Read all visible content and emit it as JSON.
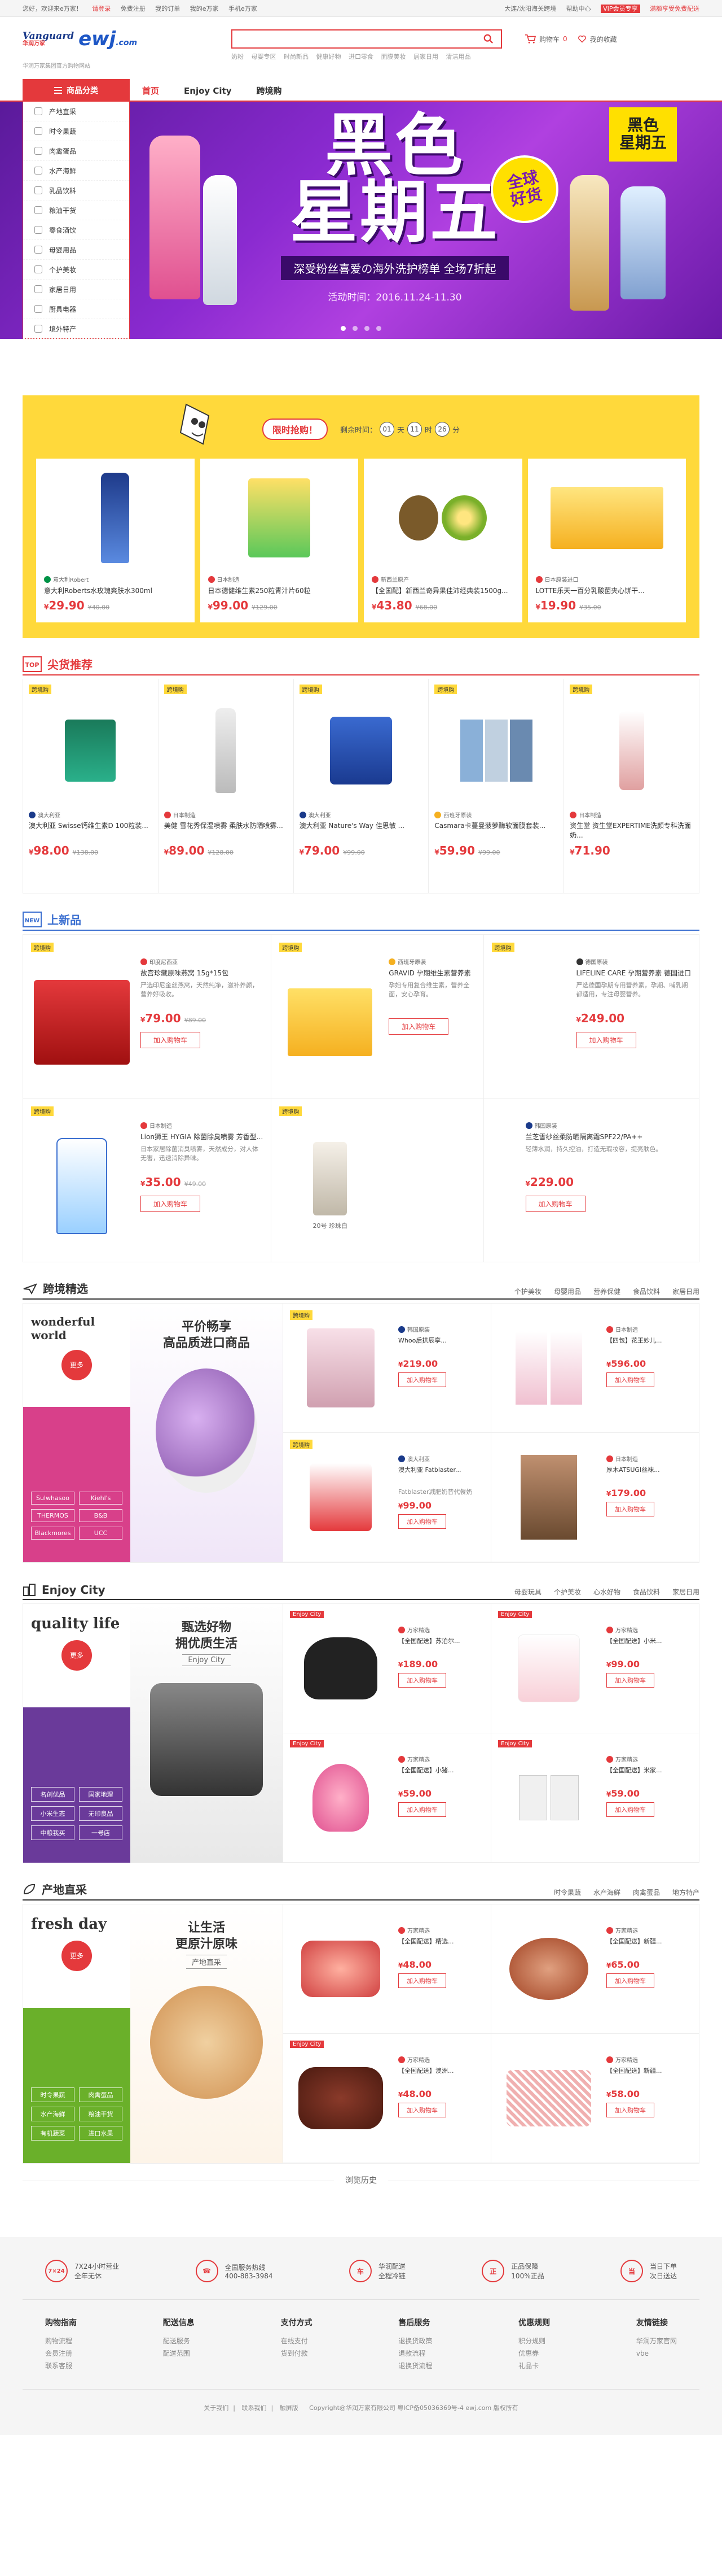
{
  "topbar": {
    "greeting": "您好，欢迎来e万家！",
    "login": "请登录",
    "register": "免费注册",
    "links": [
      "我的订单",
      "我的e万家",
      "手机e万家"
    ],
    "right": [
      "大连/沈阳海关跨境",
      "帮助中心",
      "VIP会员专享",
      "满额享受免费配送"
    ]
  },
  "header": {
    "logo_brand": "Vanguard",
    "logo_brand_cn": "华润万家",
    "logo_site": "ewj",
    "logo_domain": ".com",
    "slogan": "华润万家集团官方购物网站",
    "search_placeholder": "",
    "hot_words": [
      "奶粉",
      "母婴专区",
      "时尚新品",
      "健康好物",
      "进口零食",
      "面膜美妆",
      "居家日用",
      "清洁用品"
    ],
    "cart_label": "购物车",
    "favorite_label": "我的收藏",
    "cart_count": "0"
  },
  "nav": {
    "category_btn": "商品分类",
    "tabs": [
      "首页",
      "Enjoy City",
      "跨境购"
    ]
  },
  "categories": [
    "产地直采",
    "时令果蔬",
    "肉禽蛋品",
    "水产海鲜",
    "乳品饮料",
    "粮油干货",
    "零食酒饮",
    "母婴用品",
    "个护美妆",
    "家居日用",
    "厨具电器",
    "境外特产"
  ],
  "hero": {
    "title_line1": "黑色",
    "title_line2": "星期五",
    "badge_line1": "全球",
    "badge_line2": "好货",
    "subtitle": "深受粉丝喜爱の海外洗护榜单 全场7折起",
    "date": "活动时间：2016.11.24-11.30",
    "corner_tag_line1": "黑色",
    "corner_tag_line2": "星期五"
  },
  "flash": {
    "title": "限时抢购！",
    "timer_label": "剩余时间：",
    "timer": [
      "01",
      "11",
      "26"
    ],
    "timer_units": [
      "天",
      "时",
      "分"
    ],
    "items": [
      {
        "origin": "意大利Robert",
        "name": "意大利Roberts水玫瑰爽肤水300ml",
        "price": "29.90",
        "old": "¥40.00"
      },
      {
        "origin": "日本制造",
        "name": "日本德健维生素250粒青汁片60粒",
        "price": "99.00",
        "old": "¥129.00"
      },
      {
        "origin": "新西兰原产",
        "name": "【全国配】新西兰奇异果佳沛经典装1500g...",
        "price": "43.80",
        "old": "¥68.00"
      },
      {
        "origin": "日本原装进口",
        "name": "LOTTE乐天一百分乳酸菌夹心饼干...",
        "price": "19.90",
        "old": "¥35.00"
      }
    ]
  },
  "hot_section": {
    "title": "尖货推荐",
    "tag": "跨境购",
    "items": [
      {
        "origin": "澳大利亚",
        "name": "澳大利亚 Swisse钙维生素D 100粒装...",
        "price": "98.00",
        "old": "¥138.00"
      },
      {
        "origin": "日本制造",
        "name": "美健 雪花秀保湿喷雾 柔肤水防晒喷雾...",
        "price": "89.00",
        "old": "¥128.00"
      },
      {
        "origin": "澳大利亚",
        "name": "澳大利亚 Nature's Way 佳思敏 ...",
        "price": "79.00",
        "old": "¥99.00"
      },
      {
        "origin": "西班牙原装",
        "name": "Casmara卡蔓曼菠萝酶软面膜套装...",
        "price": "59.90",
        "old": "¥99.00"
      },
      {
        "origin": "日本制造",
        "name": "资生堂 资生堂EXPERTIME洗颜专科洗面奶...",
        "price": "71.90",
        "old": ""
      }
    ]
  },
  "new_section": {
    "title": "上新品",
    "tag": "跨境购",
    "items": [
      {
        "origin": "印度尼西亚",
        "name": "故宫珍藏原味燕窝 15g*15包",
        "desc": "严选印尼金丝燕窝，天然纯净，滋补养颜，营养好吸收。",
        "price": "79.00",
        "old": "¥89.00",
        "cart": "加入购物车"
      },
      {
        "origin": "西班牙原装",
        "name": "GRAVID 孕期维生素营养素",
        "desc": "孕妇专用复合维生素，营养全面，安心孕育。",
        "price": "",
        "old": "",
        "cart": "加入购物车"
      },
      {
        "origin": "德国原装",
        "name": "LIFELINE CARE 孕期营养素 德国进口",
        "desc": "严选德国孕期专用营养素，孕期、哺乳期都适用，专注母婴营养。",
        "price": "249.00",
        "old": "",
        "cart": "加入购物车"
      },
      {
        "origin": "日本制造",
        "name": "Lion狮王 HYGIA 除菌除臭喷雾 芳香型...",
        "price": "35.00",
        "old": "¥49.00",
        "desc": "日本家居除菌消臭喷雾，天然成分，对人体无害，迅速消除异味。",
        "cart": "加入购物车"
      },
      {
        "origin": "",
        "name": "",
        "desc": "",
        "price": "",
        "old": "",
        "cart": "",
        "sub": "20号 珍珠白"
      },
      {
        "origin": "韩国原装",
        "name": "兰芝雪纱丝柔防晒隔离霜SPF22/PA++",
        "desc": "轻薄水润，持久控油，打造无瑕妆容，提亮肤色。",
        "price": "229.00",
        "old": "",
        "cart": "加入购物车"
      }
    ]
  },
  "floor1": {
    "title": "跨境精选",
    "tabs": [
      "个护美妆",
      "母婴用品",
      "营养保健",
      "食品饮料",
      "家居日用"
    ],
    "side_title": "wonderful world",
    "more": "更多",
    "keywords": [
      "Sulwhasoo",
      "Kiehl's",
      "THERMOS",
      "B&B",
      "Blackmores",
      "UCC"
    ],
    "banner_line1": "平价畅享",
    "banner_line2": "高品质进口商品",
    "banner_sub": "",
    "items": [
      {
        "origin": "韩国原装",
        "name": "Whoo后拱辰享...",
        "price": "219.00",
        "old": "¥...",
        "cart": "加入购物车"
      },
      {
        "origin": "日本制造",
        "name": "【四包】花王妙儿...",
        "price": "596.00",
        "old": "",
        "cart": "加入购物车"
      },
      {
        "origin": "澳大利亚",
        "name": "澳大利亚 Fatblaster...",
        "desc": "Fatblaster减肥奶昔代餐奶",
        "price": "99.00",
        "old": "",
        "cart": "加入购物车"
      },
      {
        "origin": "日本制造",
        "name": "厚木ATSUGI丝袜...",
        "price": "179.00",
        "old": "",
        "cart": "加入购物车"
      }
    ]
  },
  "floor2": {
    "title": "Enjoy City",
    "tabs": [
      "母婴玩具",
      "个护美妆",
      "心水好物",
      "食品饮料",
      "家居日用"
    ],
    "side_title": "quality life",
    "more": "更多",
    "keywords": [
      "名创优品",
      "国家地理",
      "小米生态",
      "无印良品",
      "中粮我买",
      "一号店"
    ],
    "banner_line1": "甄选好物",
    "banner_line2": "拥优质生活",
    "banner_sub": "Enjoy City",
    "items": [
      {
        "origin": "万家精选",
        "name": "【全国配送】苏泊尔...",
        "price": "189.00",
        "old": "",
        "cart": "加入购物车"
      },
      {
        "origin": "万家精选",
        "name": "【全国配送】小米...",
        "price": "99.00",
        "old": "",
        "cart": "加入购物车"
      },
      {
        "origin": "万家精选",
        "name": "【全国配送】小猪...",
        "price": "59.00",
        "old": "",
        "cart": "加入购物车"
      },
      {
        "origin": "万家精选",
        "name": "【全国配送】米家...",
        "price": "59.00",
        "old": "",
        "cart": "加入购物车"
      }
    ]
  },
  "floor3": {
    "title": "产地直采",
    "tabs": [
      "时令果蔬",
      "水产海鲜",
      "肉禽蛋品",
      "地方特产"
    ],
    "side_title": "fresh  day",
    "more": "更多",
    "keywords": [
      "时令果蔬",
      "肉禽蛋品",
      "水产海鲜",
      "粮油干货",
      "有机蔬菜",
      "进口水果"
    ],
    "banner_line1": "让生活",
    "banner_line2": "更原汁原味",
    "banner_sub": "产地直采",
    "items": [
      {
        "origin": "万家精选",
        "name": "【全国配送】精选...",
        "price": "48.00",
        "old": "",
        "cart": "加入购物车"
      },
      {
        "origin": "万家精选",
        "name": "【全国配送】新疆...",
        "price": "65.00",
        "old": "",
        "cart": "加入购物车"
      },
      {
        "origin": "万家精选",
        "name": "【全国配送】澳洲...",
        "price": "48.00",
        "old": "",
        "cart": "加入购物车"
      },
      {
        "origin": "万家精选",
        "name": "【全国配送】新疆...",
        "price": "58.00",
        "old": "",
        "cart": "加入购物车"
      }
    ]
  },
  "history_label": "浏览历史",
  "footer": {
    "guarantees": [
      {
        "icon": "7×24",
        "line1": "7X24小时营业",
        "line2": "全年无休"
      },
      {
        "icon": "☎",
        "line1": "全国服务热线",
        "line2": "400-883-3984"
      },
      {
        "icon": "车",
        "line1": "华润配送",
        "line2": "全程冷链"
      },
      {
        "icon": "正",
        "line1": "正品保障",
        "line2": "100%正品"
      },
      {
        "icon": "当",
        "line1": "当日下单",
        "line2": "次日送达"
      }
    ],
    "columns": [
      {
        "title": "购物指南",
        "items": [
          "购物流程",
          "会员注册",
          "联系客服"
        ]
      },
      {
        "title": "配送信息",
        "items": [
          "配送服务",
          "配送范围"
        ]
      },
      {
        "title": "支付方式",
        "items": [
          "在线支付",
          "货到付款"
        ]
      },
      {
        "title": "售后服务",
        "items": [
          "退换货政策",
          "退款流程",
          "退换货流程"
        ]
      },
      {
        "title": "优惠规则",
        "items": [
          "积分规则",
          "优惠券",
          "礼品卡"
        ]
      },
      {
        "title": "友情链接",
        "items": [
          "华润万家官网",
          "vbe"
        ]
      }
    ],
    "bottom_links": [
      "关于我们",
      "联系我们",
      "触屏版"
    ],
    "copyright": "Copyright@华润万家有限公司 粤ICP备05036369号-4 ewj.com 版权所有"
  }
}
